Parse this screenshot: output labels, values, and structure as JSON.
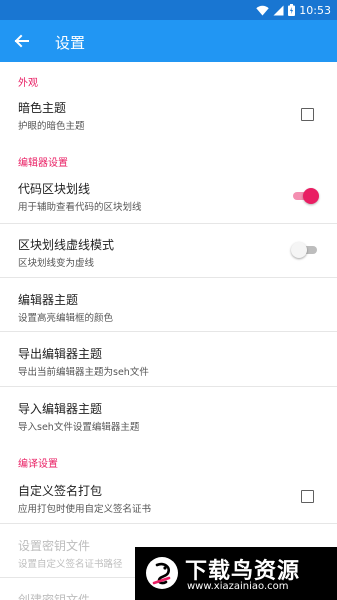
{
  "status_bar": {
    "time": "10:53"
  },
  "app_bar": {
    "title": "设置"
  },
  "sections": {
    "appearance": {
      "header": "外观"
    },
    "editor": {
      "header": "编辑器设置"
    },
    "compile": {
      "header": "编译设置"
    }
  },
  "prefs": {
    "dark_theme": {
      "title": "暗色主题",
      "summary": "护眼的暗色主题",
      "checked": false
    },
    "code_block_lines": {
      "title": "代码区块划线",
      "summary": "用于辅助查看代码的区块划线",
      "on": true
    },
    "dashed_lines": {
      "title": "区块划线虚线模式",
      "summary": "区块划线变为虚线",
      "on": false
    },
    "editor_theme": {
      "title": "编辑器主题",
      "summary": "设置高亮编辑框的颜色"
    },
    "export_theme": {
      "title": "导出编辑器主题",
      "summary": "导出当前编辑器主题为seh文件"
    },
    "import_theme": {
      "title": "导入编辑器主题",
      "summary": "导入seh文件设置编辑器主题"
    },
    "custom_sign": {
      "title": "自定义签名打包",
      "summary": "应用打包时使用自定义签名证书",
      "checked": false
    },
    "key_file": {
      "title": "设置密钥文件",
      "summary": "设置自定义签名证书路径"
    },
    "create_key": {
      "title": "创建密钥文件"
    }
  },
  "watermark": {
    "title": "下载鸟资源",
    "url": "www.xiazainiao.com"
  },
  "colors": {
    "status_bar": "#1976d2",
    "app_bar": "#2196f3",
    "accent": "#e91e63"
  }
}
